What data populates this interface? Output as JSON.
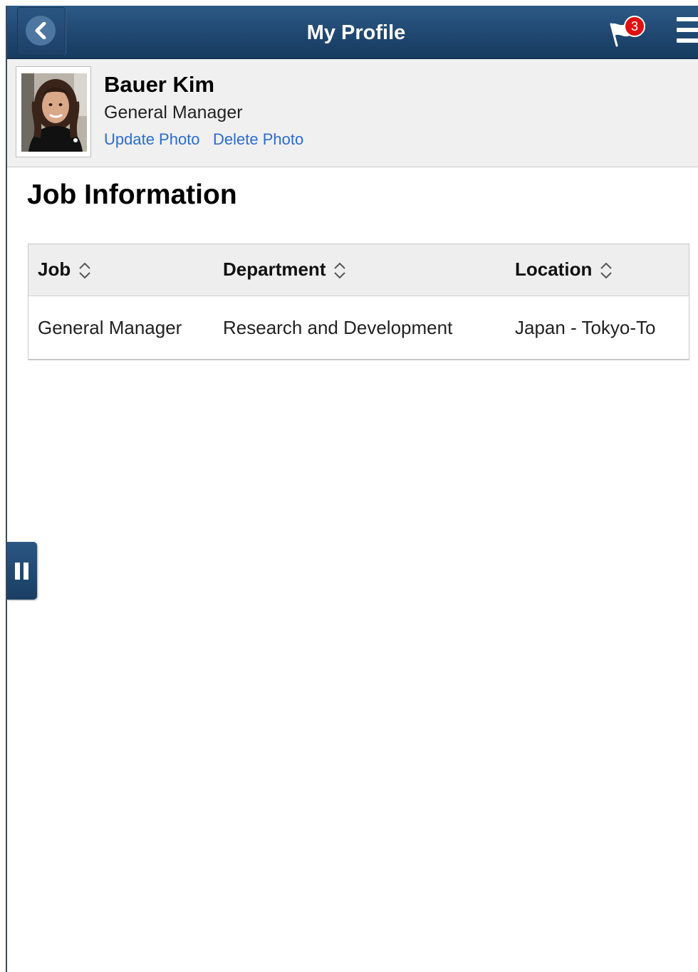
{
  "header": {
    "title": "My Profile",
    "notification_count": "3",
    "colors": {
      "banner": "#1f4770",
      "badge": "#e01010"
    }
  },
  "profile": {
    "name": "Bauer Kim",
    "title": "General Manager",
    "links": {
      "update_photo": "Update Photo",
      "delete_photo": "Delete Photo"
    },
    "link_color": "#2c6bd1"
  },
  "section": {
    "heading": "Job Information"
  },
  "job_table": {
    "columns": [
      "Job",
      "Department",
      "Location"
    ],
    "rows": [
      [
        "General Manager",
        "Research and Development",
        "Japan - Tokyo-To"
      ]
    ]
  },
  "icons": {
    "back": "chevron-left-icon",
    "notifications": "flag-icon",
    "menu": "hamburger-menu-icon",
    "sort": "sort-icon",
    "side_toggle": "pause-icon"
  }
}
